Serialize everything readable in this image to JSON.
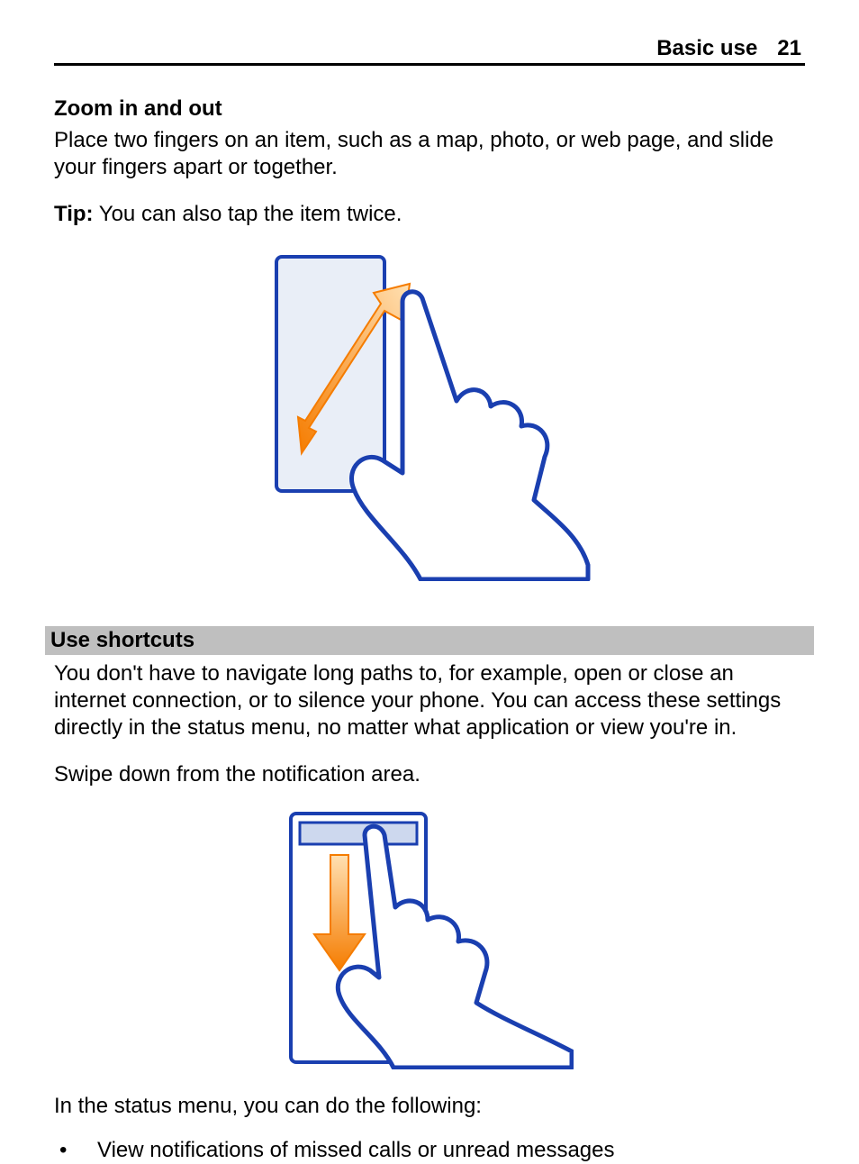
{
  "header": {
    "section": "Basic use",
    "page": "21"
  },
  "zoom": {
    "title": "Zoom in and out",
    "body": "Place two fingers on an item, such as a map, photo, or web page, and slide your fingers apart or together.",
    "tip_label": "Tip:",
    "tip_text": " You can also tap the item twice."
  },
  "shortcuts": {
    "title": "Use shortcuts",
    "body": "You don't have to navigate long paths to, for example, open or close an internet connection, or to silence your phone. You can access these settings directly in the status menu, no matter what application or view you're in.",
    "swipe": "Swipe down from the notification area.",
    "lead": "In the status menu, you can do the following:",
    "bullets": [
      "View notifications of missed calls or unread messages"
    ]
  }
}
